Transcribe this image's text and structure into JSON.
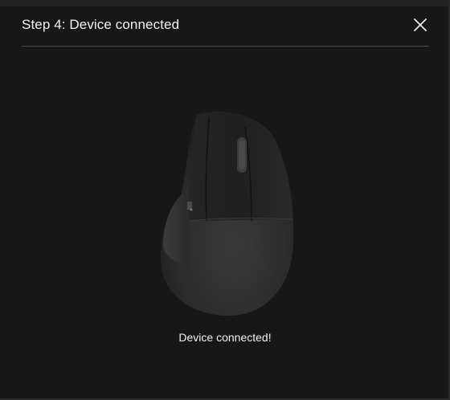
{
  "dialog": {
    "title": "Step 4: Device connected",
    "close_icon": "close-icon",
    "status": "Device connected!",
    "device_image": "vertical-mouse-image"
  }
}
